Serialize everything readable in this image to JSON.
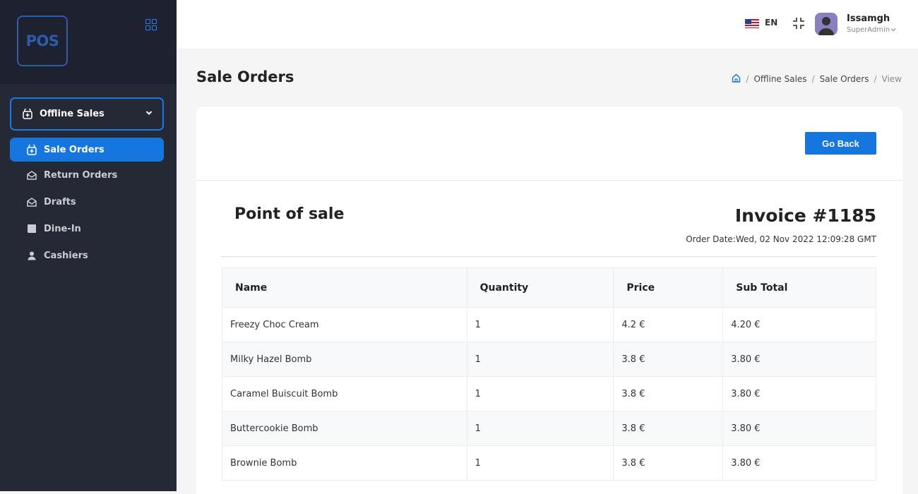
{
  "sidebar": {
    "logo_text": "POS",
    "group": {
      "label": "Offline Sales"
    },
    "items": [
      {
        "label": "Sale Orders",
        "icon": "plus-bag-icon",
        "active": true
      },
      {
        "label": "Return Orders",
        "icon": "envelope-open-icon",
        "active": false
      },
      {
        "label": "Drafts",
        "icon": "envelope-open-icon",
        "active": false
      },
      {
        "label": "Dine-In",
        "icon": "square-icon",
        "active": false
      },
      {
        "label": "Cashiers",
        "icon": "user-icon",
        "active": false
      }
    ]
  },
  "header": {
    "language": "EN",
    "user": {
      "name": "Issamgh",
      "role": "SuperAdmin"
    }
  },
  "page": {
    "title": "Sale Orders",
    "breadcrumb": [
      "Offline Sales",
      "Sale Orders",
      "View"
    ]
  },
  "card": {
    "go_back_label": "Go Back",
    "shop_name": "Point of sale",
    "invoice_title": "Invoice #1185",
    "order_date": "Order Date:Wed, 02 Nov 2022 12:09:28 GMT"
  },
  "table": {
    "headers": [
      "Name",
      "Quantity",
      "Price",
      "Sub Total"
    ],
    "rows": [
      [
        "Freezy Choc Cream",
        "1",
        "4.2 €",
        "4.20 €"
      ],
      [
        "Milky Hazel Bomb",
        "1",
        "3.8 €",
        "3.80 €"
      ],
      [
        "Caramel Buiscuit Bomb",
        "1",
        "3.8 €",
        "3.80 €"
      ],
      [
        "Buttercookie Bomb",
        "1",
        "3.8 €",
        "3.80 €"
      ],
      [
        "Brownie Bomb",
        "1",
        "3.8 €",
        "3.80 €"
      ]
    ]
  },
  "colors": {
    "accent": "#1576e0",
    "sidebar": "#252935"
  }
}
